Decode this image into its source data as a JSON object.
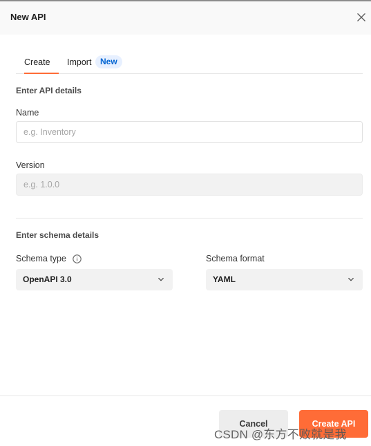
{
  "dialog": {
    "title": "New API",
    "close_icon": "close-icon"
  },
  "tabs": {
    "create_label": "Create",
    "import_label": "Import",
    "import_badge": "New",
    "active": "Create",
    "accent_color": "#ff6c37"
  },
  "api_details": {
    "section_title": "Enter API details",
    "name_label": "Name",
    "name_placeholder": "e.g. Inventory",
    "name_value": "",
    "version_label": "Version",
    "version_placeholder": "e.g. 1.0.0",
    "version_value": ""
  },
  "schema_details": {
    "section_title": "Enter schema details",
    "type_label": "Schema type",
    "type_info_icon": "info-icon",
    "type_value": "OpenAPI 3.0",
    "format_label": "Schema format",
    "format_value": "YAML"
  },
  "footer": {
    "cancel_label": "Cancel",
    "create_label": "Create API",
    "create_color": "#ff6c37"
  },
  "watermark": "CSDN @东方不败就是我"
}
